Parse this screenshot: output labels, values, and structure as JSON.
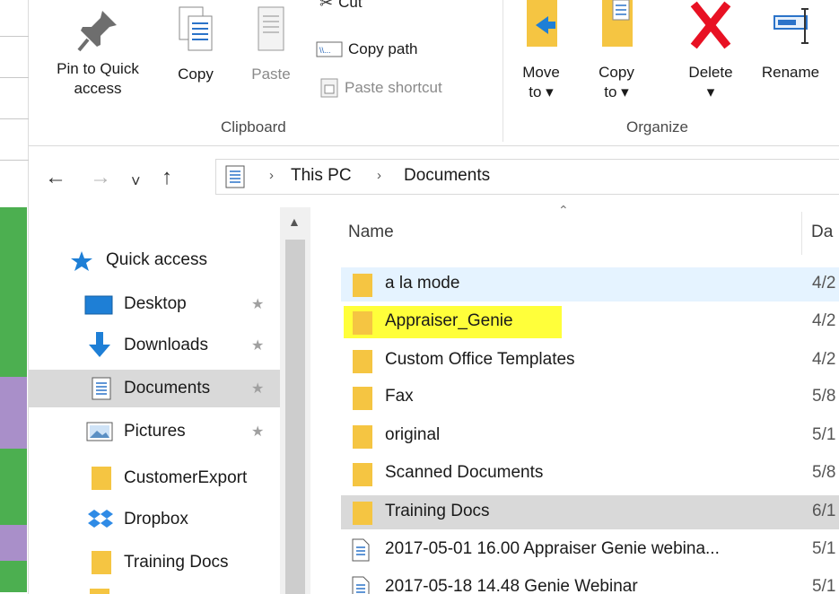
{
  "ribbon": {
    "clipboard": {
      "pin_label": [
        "Pin to Quick",
        "access"
      ],
      "copy_label": "Copy",
      "paste_label": "Paste",
      "cut_label": "Cut",
      "copy_path_label": "Copy path",
      "paste_shortcut_label": "Paste shortcut",
      "group_label": "Clipboard"
    },
    "organize": {
      "move_label": [
        "Move",
        "to ▾"
      ],
      "copy_label": [
        "Copy",
        "to ▾"
      ],
      "delete_label": [
        "Delete",
        "▾"
      ],
      "rename_label": "Rename",
      "group_label": "Organize"
    }
  },
  "address": {
    "back": "←",
    "forward": "→",
    "recent": "˅",
    "up": "↑",
    "crumbs": [
      "This PC",
      "Documents"
    ],
    "crumb_sep": "›"
  },
  "nav": {
    "items": [
      {
        "label": "Quick access",
        "icon": "star-icon",
        "pinned": false
      },
      {
        "label": "Desktop",
        "icon": "desktop-icon",
        "pinned": true
      },
      {
        "label": "Downloads",
        "icon": "download-arrow-icon",
        "pinned": true
      },
      {
        "label": "Documents",
        "icon": "documents-icon",
        "pinned": true,
        "selected": true
      },
      {
        "label": "Pictures",
        "icon": "pictures-icon",
        "pinned": true
      },
      {
        "label": "CustomerExport",
        "icon": "folder-icon",
        "pinned": false
      },
      {
        "label": "Dropbox",
        "icon": "dropbox-icon",
        "pinned": false
      },
      {
        "label": "Training Docs",
        "icon": "folder-icon",
        "pinned": false
      }
    ],
    "pin_glyph": "★"
  },
  "list": {
    "columns": {
      "name": "Name",
      "date": "Da"
    },
    "rows": [
      {
        "name": "a la mode",
        "date": "4/2",
        "type": "folder",
        "state": "hover"
      },
      {
        "name": "Appraiser_Genie",
        "date": "4/2",
        "type": "folder",
        "state": "highlight"
      },
      {
        "name": "Custom Office Templates",
        "date": "4/2",
        "type": "folder",
        "state": ""
      },
      {
        "name": "Fax",
        "date": "5/8",
        "type": "folder",
        "state": ""
      },
      {
        "name": "original",
        "date": "5/1",
        "type": "folder",
        "state": ""
      },
      {
        "name": "Scanned Documents",
        "date": "5/8",
        "type": "folder",
        "state": ""
      },
      {
        "name": "Training Docs",
        "date": "6/1",
        "type": "folder",
        "state": "selected"
      },
      {
        "name": "2017-05-01 16.00 Appraiser Genie webina...",
        "date": "5/1",
        "type": "file",
        "state": ""
      },
      {
        "name": "2017-05-18 14.48 Genie Webinar",
        "date": "5/1",
        "type": "file",
        "state": ""
      }
    ]
  },
  "colors": {
    "folder": "#f5c542",
    "highlight": "#ffff3a",
    "hover": "#e5f3ff",
    "selected": "#d9d9d9",
    "delete_red": "#e81123",
    "blue_accent": "#1e7fd6"
  }
}
